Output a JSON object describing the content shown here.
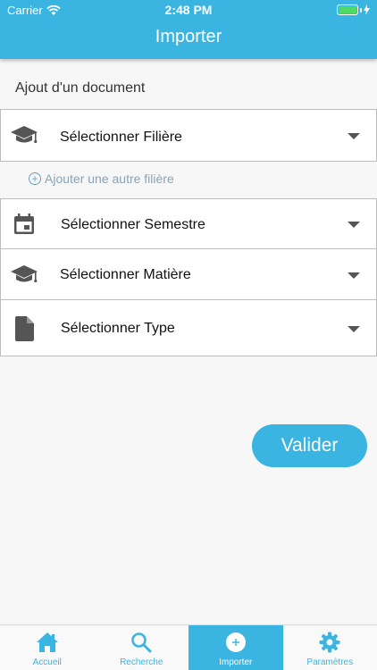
{
  "status": {
    "carrier": "Carrier",
    "time": "2:48 PM"
  },
  "header": {
    "title": "Importer"
  },
  "form": {
    "section_title": "Ajout d'un document",
    "filiere_label": "Sélectionner Filière",
    "add_filiere_label": "Ajouter une autre filière",
    "semestre_label": "Sélectionner Semestre",
    "matiere_label": "Sélectionner Matière",
    "type_label": "Sélectionner Type",
    "submit_label": "Valider"
  },
  "tabs": [
    {
      "label": "Accueil",
      "icon": "home-icon"
    },
    {
      "label": "Recherche",
      "icon": "search-icon"
    },
    {
      "label": "Importer",
      "icon": "plus-circle-icon",
      "active": true
    },
    {
      "label": "Paramètres",
      "icon": "gear-icon"
    }
  ],
  "colors": {
    "accent": "#3ab4e0",
    "icon": "#555555",
    "link": "#8aa3b5"
  }
}
